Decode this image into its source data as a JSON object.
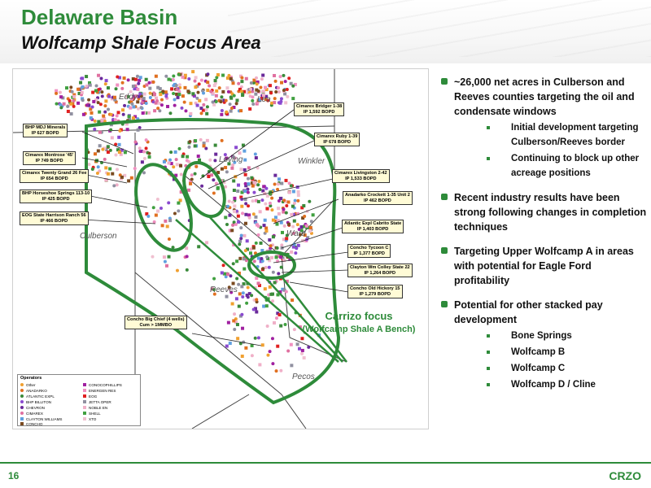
{
  "slide": {
    "title": "Delaware Basin",
    "subtitle": "Wolfcamp Shale Focus Area",
    "page_number": "16",
    "logo_text": "CRZO"
  },
  "map": {
    "counties": {
      "eddy": "Eddy",
      "lea": "Lea",
      "loving": "Loving",
      "winkler": "Winkler",
      "culberson": "Culberson",
      "ward": "Ward",
      "reeves": "Reeves",
      "pecos": "Pecos"
    },
    "callouts": [
      {
        "line1": "BHP MDJ Minerals",
        "line2": "IP 627 BOPD"
      },
      {
        "line1": "Cimarex Montrose '45'",
        "line2": "IP 749 BOPD"
      },
      {
        "line1": "Cimarex Twenty Grand 26 Fee",
        "line2": "IP 654 BOPD"
      },
      {
        "line1": "BHP Horseshoe Springs 113-10",
        "line2": "IP 425 BOPD"
      },
      {
        "line1": "EOG State Harrison Ranch 56",
        "line2": "IP 466 BOPD"
      },
      {
        "line1": "Cimarex Bridger 1-38",
        "line2": "IP 1,592 BOPD"
      },
      {
        "line1": "Cimarex Ruby 1-39",
        "line2": "IP 678 BOPD"
      },
      {
        "line1": "Cimarex Livingston 2-42",
        "line2": "IP 1,533 BOPD"
      },
      {
        "line1": "Anadarko Crockett 1-35 Unit 2",
        "line2": "IP 462 BOPD"
      },
      {
        "line1": "Atlantic Expl Cabrito State",
        "line2": "IP 1,403 BOPD"
      },
      {
        "line1": "Concho Tycoon C",
        "line2": "IP 1,377 BOPD"
      },
      {
        "line1": "Clayton Wm Colley State 22",
        "line2": "IP 1,264 BOPD"
      },
      {
        "line1": "Concho Old Hickory 15",
        "line2": "IP 1,279 BOPD"
      },
      {
        "line1": "Concho Big Chief (4 wells)",
        "line2": "Cum > 1MMBO"
      }
    ],
    "legend": {
      "title": "Operators",
      "items": [
        {
          "label": "Other",
          "color": "#f0a030"
        },
        {
          "label": "ANADARKO",
          "color": "#e07020"
        },
        {
          "label": "ATLANTIC EXPL",
          "color": "#3a8a3a"
        },
        {
          "label": "BHP BILLITON",
          "color": "#8a4ad0"
        },
        {
          "label": "CHEVRON",
          "color": "#6a2a9a"
        },
        {
          "label": "CIMAREX",
          "color": "#e070a0"
        },
        {
          "label": "CLAYTON WILLIAMS",
          "color": "#60a0e0"
        },
        {
          "label": "CONCHO",
          "color": "#7a4a20"
        },
        {
          "label": "CONOCOPHILLIPS",
          "color": "#a020a0"
        },
        {
          "label": "ENERGEN RES",
          "color": "#f090c0"
        },
        {
          "label": "EOG",
          "color": "#e02020"
        },
        {
          "label": "JETTA OPER",
          "color": "#9090a0"
        },
        {
          "label": "NOBLE EN",
          "color": "#f0b0c8"
        },
        {
          "label": "SHELL",
          "color": "#40a040"
        },
        {
          "label": "XTO",
          "color": "#f0c0d0"
        }
      ]
    },
    "focus_label": {
      "line1": "Carrizo focus",
      "line2": "(Wolfcamp Shale A Bench)"
    },
    "colors": {
      "accent": "#2e8b3a",
      "outline": "#2e8b3a"
    }
  },
  "bullets": [
    {
      "text": "~26,000 net acres in Culberson and Reeves counties targeting the oil and condensate windows",
      "sub": [
        "Initial development targeting Culberson/Reeves border",
        "Continuing to block up other acreage positions"
      ]
    },
    {
      "text": "Recent industry results have been strong following changes in completion techniques",
      "sub": []
    },
    {
      "text": "Targeting Upper Wolfcamp A in areas with potential for Eagle Ford profitability",
      "sub": []
    },
    {
      "text": "Potential for other stacked pay development",
      "sub": [
        "Bone Springs",
        "Wolfcamp B",
        "Wolfcamp C",
        "Wolfcamp D / Cline"
      ]
    }
  ]
}
